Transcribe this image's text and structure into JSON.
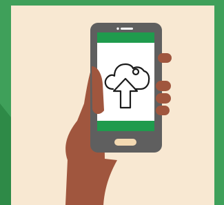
{
  "illustration": {
    "subject": "hand-holding-phone-cloud-upload",
    "icon": "cloud-upload-icon"
  },
  "colors": {
    "border_green": "#3fa05a",
    "border_green_dark": "#2e8a47",
    "background_cream": "#f8e8d2",
    "skin_brown": "#a0563e",
    "phone_body": "#5f5f5f",
    "phone_bar_green": "#1f9b4d",
    "phone_screen": "#ffffff",
    "home_button": "#f3d9b2",
    "icon_stroke": "#1a1a1a"
  }
}
